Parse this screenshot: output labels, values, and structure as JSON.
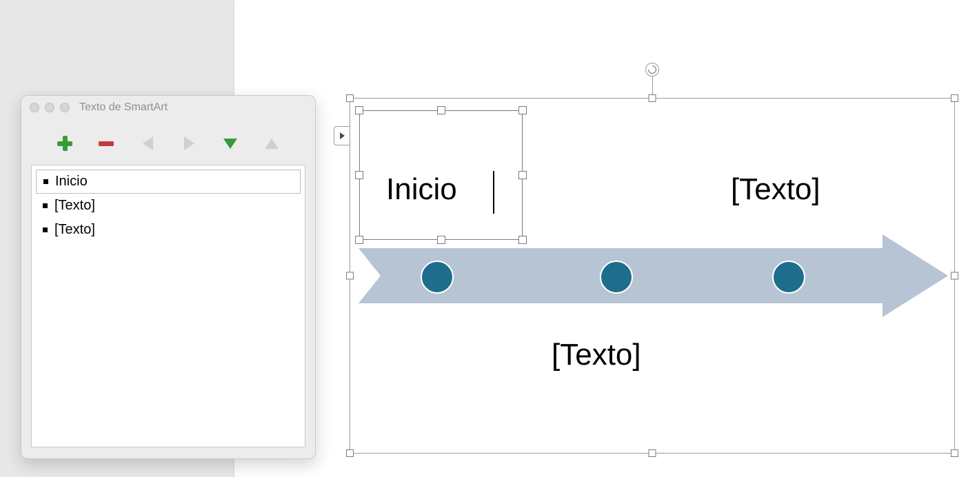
{
  "panel": {
    "title": "Texto de SmartArt",
    "items": [
      {
        "text": "Inicio",
        "selected": true
      },
      {
        "text": "[Texto]",
        "selected": false
      },
      {
        "text": "[Texto]",
        "selected": false
      }
    ]
  },
  "smartart": {
    "labels": {
      "node1": "Inicio",
      "node2": "[Texto]",
      "node3": "[Texto]"
    },
    "colors": {
      "arrow_fill": "#b6c4d4",
      "dot_fill": "#1f6d8c"
    }
  }
}
